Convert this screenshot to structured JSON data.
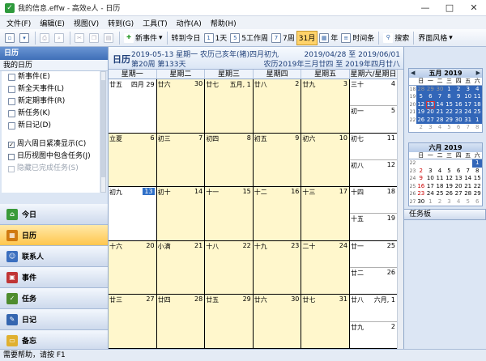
{
  "window": {
    "title": "我的信息.effw - 高效e人 - 日历",
    "controls": [
      "—",
      "□",
      "✕"
    ]
  },
  "menu": [
    "文件(F)",
    "编辑(E)",
    "视图(V)",
    "转到(G)",
    "工具(T)",
    "动作(A)",
    "帮助(H)"
  ],
  "toolbar": {
    "new_item": "新事件",
    "goto_today": "转到今日",
    "day": "1天",
    "workweek": "5工作周",
    "week": "7周",
    "month": "31月",
    "year": "年",
    "timeline": "时间条",
    "search": "搜索",
    "style": "界面风格"
  },
  "left": {
    "header": "日历",
    "my_calendar": "我的日历",
    "create_items": [
      "新事件(E)",
      "新全天事件(L)",
      "新定期事件(R)",
      "新任务(K)",
      "新日记(D)"
    ],
    "options": [
      {
        "label": "周六周日紧凑显示(C)",
        "checked": true
      },
      {
        "label": "日历视图中包含任务(J)",
        "checked": false
      },
      {
        "label": "隐藏已完成任务(S)",
        "checked": false
      }
    ],
    "nav": [
      {
        "label": "今日",
        "color": "#3a9a3a"
      },
      {
        "label": "日历",
        "color": "#d07a10"
      },
      {
        "label": "联系人",
        "color": "#3b6fbf"
      },
      {
        "label": "事件",
        "color": "#c03535"
      },
      {
        "label": "任务",
        "color": "#4e8c2e"
      },
      {
        "label": "日记",
        "color": "#3566b0"
      },
      {
        "label": "备忘",
        "color": "#e0b030"
      }
    ]
  },
  "calendar": {
    "title": "日历",
    "line1": "2019-05-13 星期一 农历己亥年(猪)四月初九",
    "line2": "第20周 第133天",
    "range": "2019/04/28 至 2019/06/01",
    "lunar_range": "农历2019年三月廿四 至 2019年四月廿八",
    "weekdays": [
      "星期一",
      "星期二",
      "星期三",
      "星期四",
      "星期五",
      "星期六/星期日"
    ],
    "weeks": [
      {
        "days": [
          {
            "l": "廿五",
            "n": "四月 29"
          },
          {
            "l": "廿六",
            "n": "30"
          },
          {
            "l": "廿七",
            "n": "五月, 1"
          },
          {
            "l": "廿八",
            "n": "2"
          },
          {
            "l": "廿九",
            "n": "3"
          }
        ],
        "weekend": [
          {
            "l": "三十",
            "n": "4"
          },
          {
            "l": "初一",
            "n": "5"
          }
        ]
      },
      {
        "days": [
          {
            "l": "立夏",
            "n": "6"
          },
          {
            "l": "初三",
            "n": "7"
          },
          {
            "l": "初四",
            "n": "8"
          },
          {
            "l": "初五",
            "n": "9"
          },
          {
            "l": "初六",
            "n": "10"
          }
        ],
        "weekend": [
          {
            "l": "初七",
            "n": "11"
          },
          {
            "l": "初八",
            "n": "12"
          }
        ]
      },
      {
        "days": [
          {
            "l": "初九",
            "n": "13"
          },
          {
            "l": "初十",
            "n": "14"
          },
          {
            "l": "十一",
            "n": "15"
          },
          {
            "l": "十二",
            "n": "16"
          },
          {
            "l": "十三",
            "n": "17"
          }
        ],
        "weekend": [
          {
            "l": "十四",
            "n": "18"
          },
          {
            "l": "十五",
            "n": "19"
          }
        ]
      },
      {
        "days": [
          {
            "l": "十六",
            "n": "20"
          },
          {
            "l": "小满",
            "n": "21"
          },
          {
            "l": "十八",
            "n": "22"
          },
          {
            "l": "十九",
            "n": "23"
          },
          {
            "l": "二十",
            "n": "24"
          }
        ],
        "weekend": [
          {
            "l": "廿一",
            "n": "25"
          },
          {
            "l": "廿二",
            "n": "26"
          }
        ]
      },
      {
        "days": [
          {
            "l": "廿三",
            "n": "27"
          },
          {
            "l": "廿四",
            "n": "28"
          },
          {
            "l": "廿五",
            "n": "29"
          },
          {
            "l": "廿六",
            "n": "30"
          },
          {
            "l": "廿七",
            "n": "31"
          }
        ],
        "weekend": [
          {
            "l": "廿八",
            "n": "六月, 1"
          },
          {
            "l": "廿九",
            "n": "2"
          }
        ]
      }
    ]
  },
  "mini_cals": [
    {
      "title": "五月 2019",
      "dow": [
        "日",
        "一",
        "二",
        "三",
        "四",
        "五",
        "六"
      ],
      "rows": [
        {
          "wk": "18",
          "d": [
            "28",
            "29",
            "30",
            "1",
            "2",
            "3",
            "4"
          ]
        },
        {
          "wk": "19",
          "d": [
            "5",
            "6",
            "7",
            "8",
            "9",
            "10",
            "11"
          ]
        },
        {
          "wk": "20",
          "d": [
            "12",
            "13",
            "14",
            "15",
            "16",
            "17",
            "18"
          ]
        },
        {
          "wk": "21",
          "d": [
            "19",
            "20",
            "21",
            "22",
            "23",
            "24",
            "25"
          ]
        },
        {
          "wk": "22",
          "d": [
            "26",
            "27",
            "28",
            "29",
            "30",
            "31",
            "1"
          ]
        },
        {
          "wk": "",
          "d": [
            "2",
            "3",
            "4",
            "5",
            "6",
            "7",
            "8"
          ]
        }
      ]
    },
    {
      "title": "六月 2019",
      "dow": [
        "日",
        "一",
        "二",
        "三",
        "四",
        "五",
        "六"
      ],
      "rows": [
        {
          "wk": "22",
          "d": [
            "",
            "",
            "",
            "",
            "",
            "",
            "1"
          ]
        },
        {
          "wk": "23",
          "d": [
            "2",
            "3",
            "4",
            "5",
            "6",
            "7",
            "8"
          ]
        },
        {
          "wk": "24",
          "d": [
            "9",
            "10",
            "11",
            "12",
            "13",
            "14",
            "15"
          ]
        },
        {
          "wk": "25",
          "d": [
            "16",
            "17",
            "18",
            "19",
            "20",
            "21",
            "22"
          ]
        },
        {
          "wk": "26",
          "d": [
            "23",
            "24",
            "25",
            "26",
            "27",
            "28",
            "29"
          ]
        },
        {
          "wk": "27",
          "d": [
            "30",
            "1",
            "2",
            "3",
            "4",
            "5",
            "6"
          ]
        }
      ]
    }
  ],
  "task_panel": "任务板",
  "status": "需要帮助，请按 F1"
}
